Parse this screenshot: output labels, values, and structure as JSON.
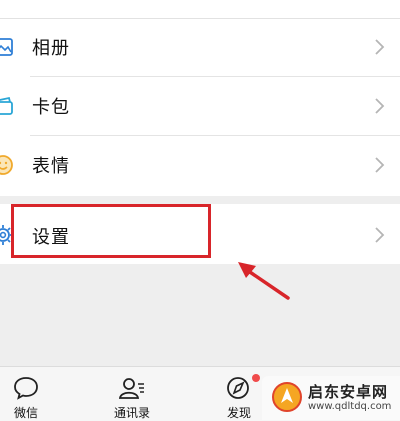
{
  "menu": {
    "items": [
      {
        "label": "相册",
        "icon": "photo-album-icon"
      },
      {
        "label": "卡包",
        "icon": "card-wallet-icon"
      },
      {
        "label": "表情",
        "icon": "emoji-icon"
      },
      {
        "label": "设置",
        "icon": "gear-icon"
      }
    ]
  },
  "tabbar": {
    "tabs": [
      {
        "label": "微信",
        "icon": "chat-bubble-icon"
      },
      {
        "label": "通讯录",
        "icon": "contacts-icon"
      },
      {
        "label": "发现",
        "icon": "compass-icon"
      }
    ]
  },
  "watermark": {
    "title": "启东安卓网",
    "url": "www.qdltdq.com"
  },
  "colors": {
    "highlight": "#d8252a",
    "accent": "#1aad19",
    "badge": "#f04b4b"
  }
}
